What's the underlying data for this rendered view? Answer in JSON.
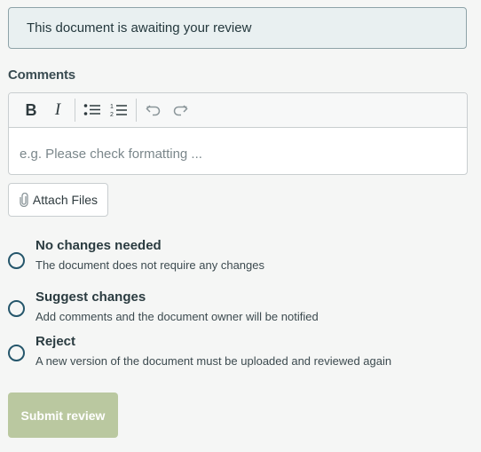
{
  "banner": {
    "text": "This document is awaiting your review"
  },
  "comments": {
    "label": "Comments",
    "placeholder": "e.g. Please check formatting ...",
    "toolbar": {
      "bold": "B",
      "italic": "I"
    }
  },
  "attach": {
    "label": "Attach Files",
    "icon": "paperclip-icon"
  },
  "options": [
    {
      "title": "No changes needed",
      "desc": "The document does not require any changes"
    },
    {
      "title": "Suggest changes",
      "desc": "Add comments and the document owner will be notified"
    },
    {
      "title": "Reject",
      "desc": "A new version of the document must be uploaded and reviewed again"
    }
  ],
  "submit": {
    "label": "Submit review"
  },
  "colors": {
    "radio": "#25566b",
    "submit_bg": "#bac8a0",
    "banner_bg": "#e9f0f1"
  }
}
